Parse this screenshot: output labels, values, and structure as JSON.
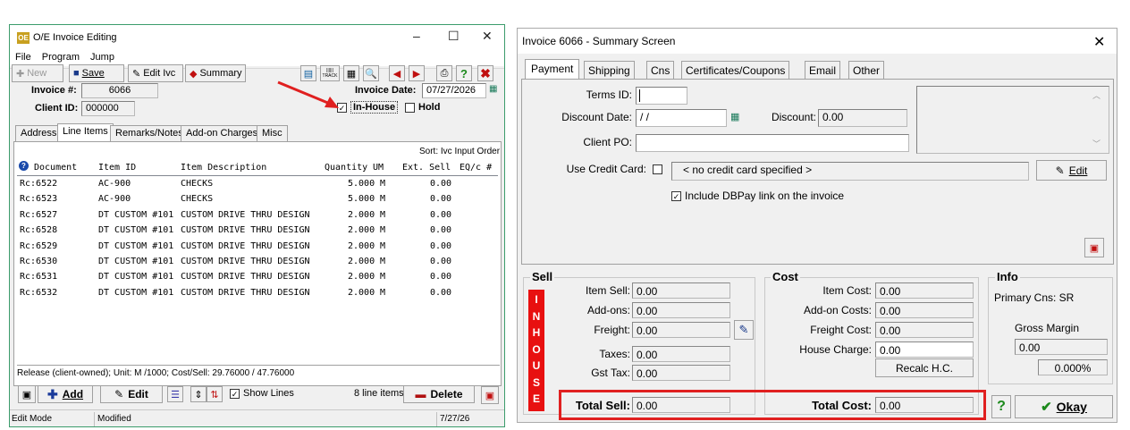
{
  "left_window": {
    "title": "O/E Invoice Editing",
    "app_badge": "OE",
    "menu": [
      "File",
      "Program",
      "Jump"
    ],
    "toolbar": {
      "new_label": "New",
      "save_label": "Save",
      "edit_ivc_label": "Edit Ivc",
      "summary_label": "Summary",
      "track_label": "TRACK"
    },
    "header": {
      "invoice_label": "Invoice #:",
      "invoice_value": "6066",
      "client_label": "Client ID:",
      "client_value": "000000",
      "invoice_date_label": "Invoice Date:",
      "invoice_date_value": "07/27/2026",
      "inhouse_label": "In-House",
      "inhouse_checked": true,
      "hold_label": "Hold",
      "hold_checked": false
    },
    "tabs": [
      "Address",
      "Line Items",
      "Remarks/Notes",
      "Add-on Charges",
      "Misc"
    ],
    "active_tab": "Line Items",
    "sort_label": "Sort: Ivc Input Order",
    "columns": [
      "Document",
      "Item ID",
      "Item Description",
      "Quantity",
      "UM",
      "Ext. Sell",
      "EQ/c #"
    ],
    "rows": [
      {
        "doc": "Rc:6522",
        "item": "AC-900",
        "desc": "CHECKS",
        "qty": "5.000",
        "um": "M",
        "sell": "0.00"
      },
      {
        "doc": "Rc:6523",
        "item": "AC-900",
        "desc": "CHECKS",
        "qty": "5.000",
        "um": "M",
        "sell": "0.00"
      },
      {
        "doc": "Rc:6527",
        "item": "DT CUSTOM #101",
        "desc": "CUSTOM DRIVE THRU DESIGN",
        "qty": "2.000",
        "um": "M",
        "sell": "0.00"
      },
      {
        "doc": "Rc:6528",
        "item": "DT CUSTOM #101",
        "desc": "CUSTOM DRIVE THRU DESIGN",
        "qty": "2.000",
        "um": "M",
        "sell": "0.00"
      },
      {
        "doc": "Rc:6529",
        "item": "DT CUSTOM #101",
        "desc": "CUSTOM DRIVE THRU DESIGN",
        "qty": "2.000",
        "um": "M",
        "sell": "0.00"
      },
      {
        "doc": "Rc:6530",
        "item": "DT CUSTOM #101",
        "desc": "CUSTOM DRIVE THRU DESIGN",
        "qty": "2.000",
        "um": "M",
        "sell": "0.00"
      },
      {
        "doc": "Rc:6531",
        "item": "DT CUSTOM #101",
        "desc": "CUSTOM DRIVE THRU DESIGN",
        "qty": "2.000",
        "um": "M",
        "sell": "0.00"
      },
      {
        "doc": "Rc:6532",
        "item": "DT CUSTOM #101",
        "desc": "CUSTOM DRIVE THRU DESIGN",
        "qty": "2.000",
        "um": "M",
        "sell": "0.00"
      }
    ],
    "info_line": "Release (client-owned); Unit: M /1000; Cost/Sell: 29.76000 / 47.76000",
    "bottom": {
      "add_label": "Add",
      "edit_label": "Edit",
      "show_lines_label": "Show Lines",
      "show_lines_checked": true,
      "line_count": "8 line items",
      "delete_label": "Delete"
    },
    "status": {
      "mode": "Edit Mode",
      "state": "Modified",
      "date": "7/27/26"
    }
  },
  "right_window": {
    "title": "Invoice 6066 - Summary Screen",
    "tabs": [
      "Payment",
      "Shipping",
      "Cns",
      "Certificates/Coupons",
      "Email",
      "Other"
    ],
    "active_tab": "Payment",
    "payment": {
      "terms_label": "Terms ID:",
      "terms_value": "",
      "discount_date_label": "Discount Date:",
      "discount_date_value": " / /",
      "discount_label": "Discount:",
      "discount_value": "0.00",
      "client_po_label": "Client PO:",
      "client_po_value": "",
      "use_cc_label": "Use Credit Card:",
      "use_cc_checked": false,
      "cc_value": "< no credit card specified >",
      "edit_label": "Edit",
      "dbpay_label": "Include DBPay link on the invoice",
      "dbpay_checked": true
    },
    "sell": {
      "title": "Sell",
      "inhouse_letters": [
        "I",
        "N",
        "H",
        "O",
        "U",
        "S",
        "E"
      ],
      "item_sell_label": "Item Sell:",
      "item_sell_value": "0.00",
      "addons_label": "Add-ons:",
      "addons_value": "0.00",
      "freight_label": "Freight:",
      "freight_value": "0.00",
      "taxes_label": "Taxes:",
      "taxes_value": "0.00",
      "gst_label": "Gst Tax:",
      "gst_value": "0.00",
      "total_label": "Total Sell:",
      "total_value": "0.00"
    },
    "cost": {
      "title": "Cost",
      "item_cost_label": "Item Cost:",
      "item_cost_value": "0.00",
      "addon_costs_label": "Add-on Costs:",
      "addon_costs_value": "0.00",
      "freight_cost_label": "Freight Cost:",
      "freight_cost_value": "0.00",
      "house_charge_label": "House Charge:",
      "house_charge_value": "0.00",
      "recalc_label": "Recalc H.C.",
      "total_label": "Total Cost:",
      "total_value": "0.00"
    },
    "info": {
      "title": "Info",
      "primary_cns": "Primary Cns: SR",
      "gross_margin_label": "Gross Margin",
      "gross_margin_value": "0.00",
      "gross_margin_pct": "0.000%"
    },
    "okay_label": "Okay",
    "help_label": "?"
  },
  "colors": {
    "highlight_red": "#e02020",
    "inhouse_bg": "#e81010",
    "border_green": "#3c9c6c"
  }
}
